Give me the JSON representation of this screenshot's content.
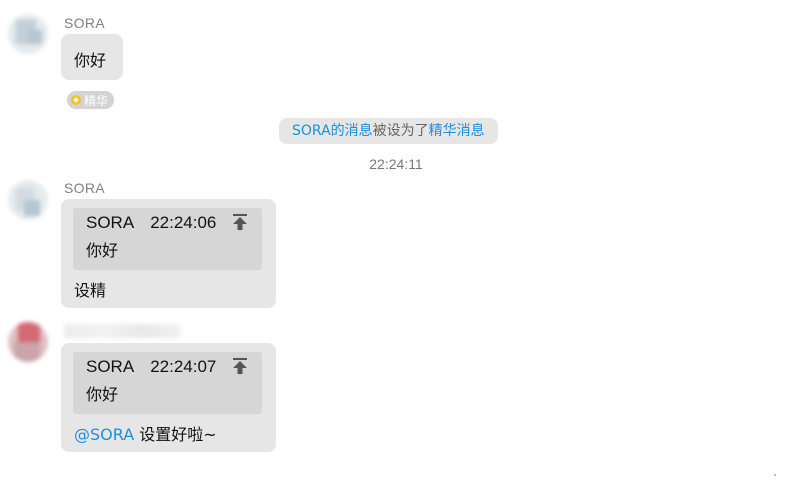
{
  "messages": [
    {
      "sender": "SORA",
      "text": "你好",
      "badge": "精华"
    },
    {
      "sender": "SORA",
      "quote": {
        "author": "SORA",
        "time": "22:24:06",
        "text": "你好"
      },
      "text": "设精"
    },
    {
      "sender": "",
      "quote": {
        "author": "SORA",
        "time": "22:24:07",
        "text": "你好"
      },
      "mention": "@SORA",
      "text": "设置好啦~"
    }
  ],
  "system_notice": {
    "part1": "SORA的消息",
    "part2": "被设为了",
    "part3": "精华消息"
  },
  "timestamp": "22:24:11",
  "colors": {
    "bubble": "#e6e6e6",
    "quote_bg": "#d6d6d6",
    "link_blue": "#1a8fe0",
    "essence_gold": "#f5c518"
  },
  "icons": {
    "quote_jump": "arrow-up-to-top-icon",
    "essence": "diamond-badge-icon"
  }
}
